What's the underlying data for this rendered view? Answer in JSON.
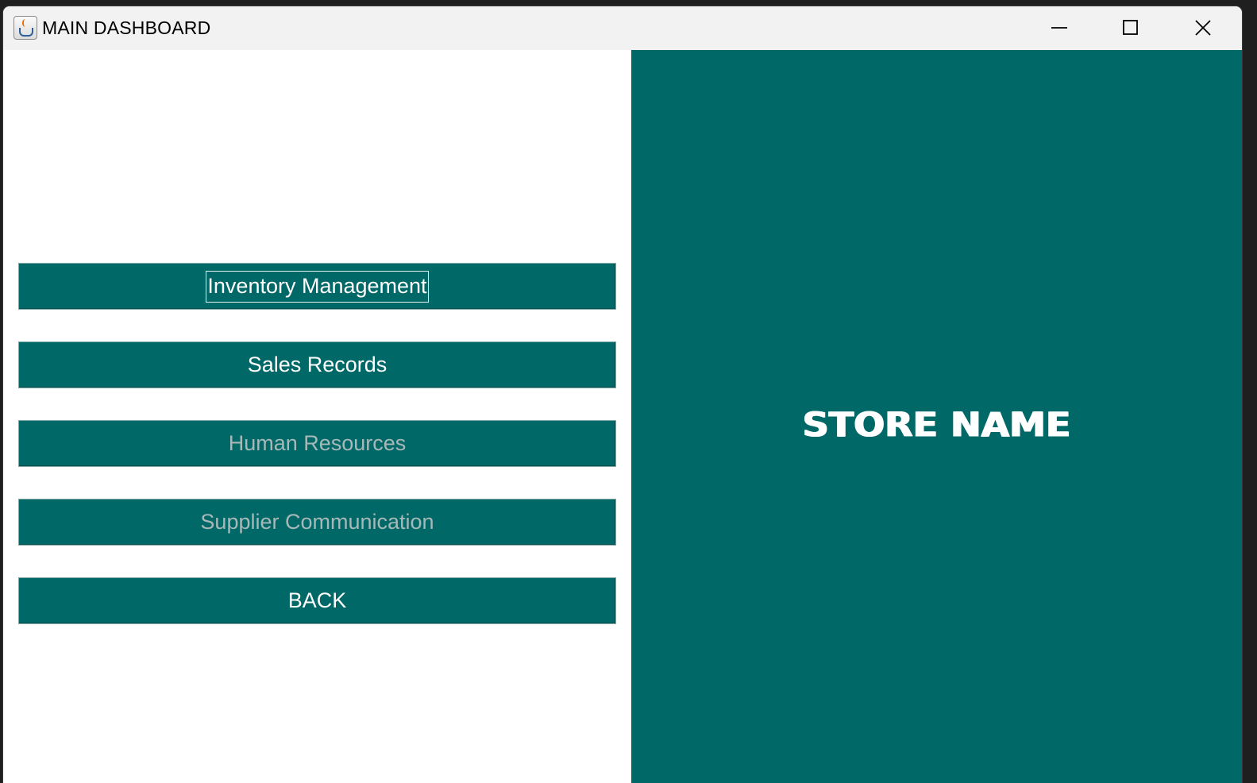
{
  "window": {
    "title": "MAIN DASHBOARD",
    "app_icon": "java-app-icon",
    "controls": {
      "minimize_icon": "minimize-icon",
      "maximize_icon": "maximize-icon",
      "close_icon": "close-icon"
    }
  },
  "menu": {
    "items": [
      {
        "label": "Inventory Management",
        "enabled": true,
        "focused": true
      },
      {
        "label": "Sales Records",
        "enabled": true,
        "focused": false
      },
      {
        "label": "Human Resources",
        "enabled": false,
        "focused": false
      },
      {
        "label": "Supplier Communication",
        "enabled": false,
        "focused": false
      },
      {
        "label": "BACK",
        "enabled": true,
        "focused": false
      }
    ]
  },
  "brand_panel": {
    "store_name": "STORE NAME"
  },
  "colors": {
    "accent": "#016868",
    "button_text": "#ffffff",
    "disabled_text": "#a7b8b8",
    "titlebar": "#f2f2f2"
  }
}
